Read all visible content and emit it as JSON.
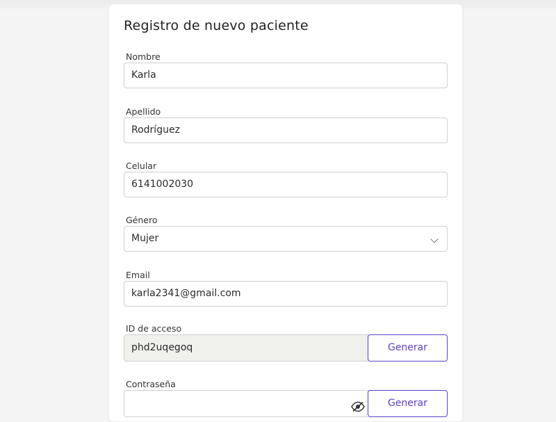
{
  "form": {
    "title": "Registro de nuevo paciente",
    "fields": {
      "nombre": {
        "label": "Nombre",
        "value": "Karla"
      },
      "apellido": {
        "label": "Apellido",
        "value": "Rodríguez"
      },
      "celular": {
        "label": "Celular",
        "value": "6141002030"
      },
      "genero": {
        "label": "Género",
        "value": "Mujer"
      },
      "email": {
        "label": "Email",
        "value": "karla2341@gmail.com"
      },
      "id_acceso": {
        "label": "ID de acceso",
        "value": "phd2uqegoq",
        "button": "Generar"
      },
      "contrasena": {
        "label": "Contraseña",
        "value": "",
        "button": "Generar"
      }
    }
  },
  "icons": {
    "genero_select": "chevron-down-icon",
    "password_toggle": "eye-slash-icon"
  },
  "colors": {
    "accent": "#5a3fc8",
    "readonly_bg": "#f0f0ec",
    "page_bg": "#f4f4f4"
  }
}
